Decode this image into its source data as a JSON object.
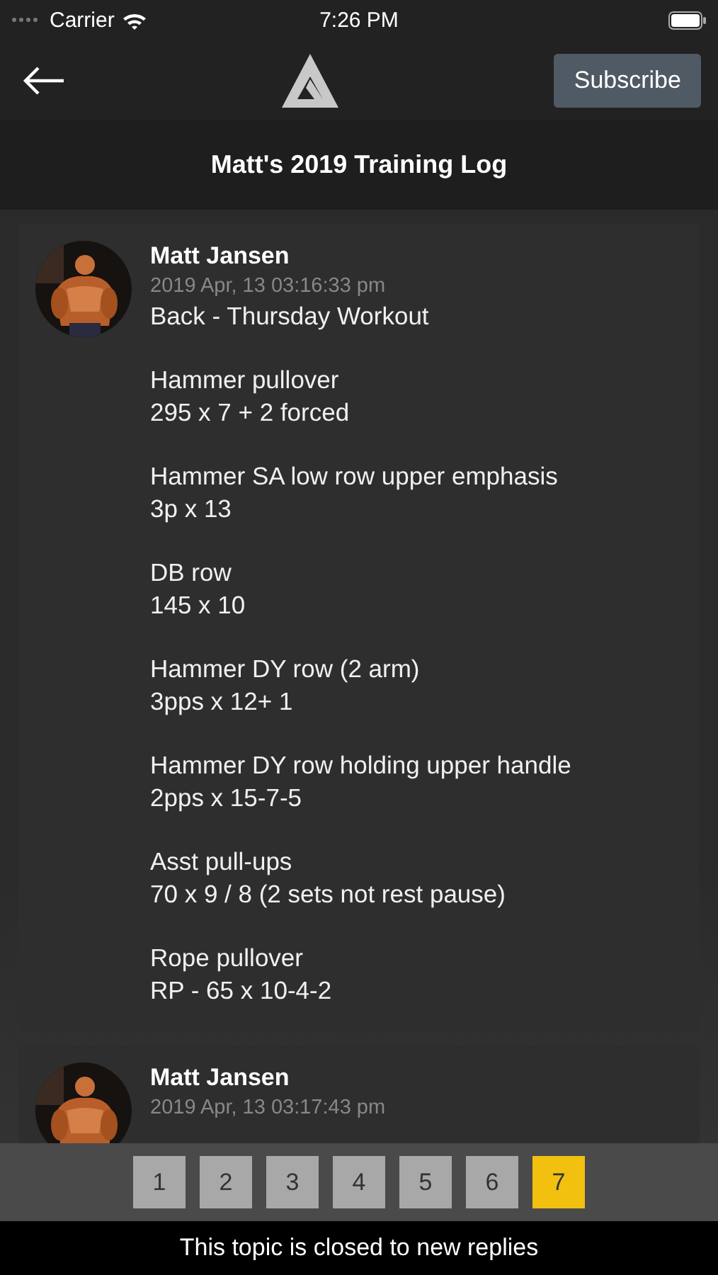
{
  "status_bar": {
    "carrier": "Carrier",
    "time": "7:26 PM"
  },
  "nav": {
    "subscribe": "Subscribe"
  },
  "title": "Matt's 2019 Training Log",
  "posts": [
    {
      "author": "Matt Jansen",
      "date": "2019 Apr, 13 03:16:33 pm",
      "heading": "Back - Thursday Workout",
      "exercises": [
        {
          "name": "Hammer pullover",
          "sets": "295 x 7 + 2 forced"
        },
        {
          "name": "Hammer SA low row upper emphasis",
          "sets": "3p x 13"
        },
        {
          "name": "DB row",
          "sets": "145 x 10"
        },
        {
          "name": "Hammer DY row (2 arm)",
          "sets": "3pps x 12+ 1"
        },
        {
          "name": "Hammer DY row holding upper handle",
          "sets": "2pps x 15-7-5"
        },
        {
          "name": "Asst pull-ups",
          "sets": "70 x 9 / 8 (2 sets not rest pause)"
        },
        {
          "name": "Rope pullover",
          "sets": "RP - 65 x 10-4-2"
        }
      ]
    },
    {
      "author": "Matt Jansen",
      "date": "2019 Apr, 13 03:17:43 pm"
    }
  ],
  "pages": [
    {
      "label": "1",
      "selected": false
    },
    {
      "label": "2",
      "selected": false
    },
    {
      "label": "3",
      "selected": false
    },
    {
      "label": "4",
      "selected": false
    },
    {
      "label": "5",
      "selected": false
    },
    {
      "label": "6",
      "selected": false
    },
    {
      "label": "7",
      "selected": true
    }
  ],
  "footer": "This topic is closed to new replies"
}
